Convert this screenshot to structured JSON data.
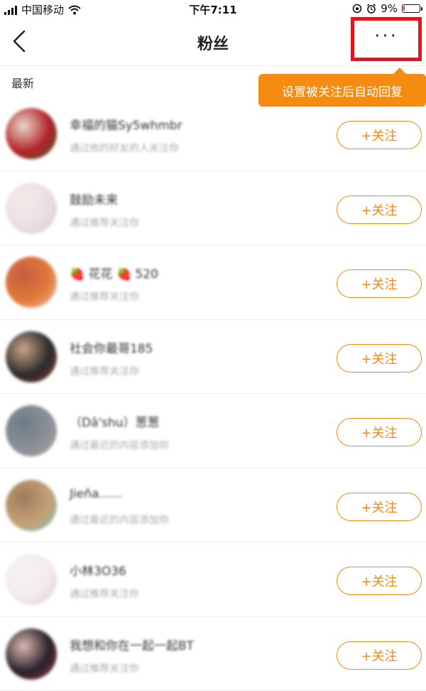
{
  "status_bar": {
    "carrier": "中国移动",
    "time": "下午7:11",
    "battery": "9%",
    "battery_level": 0.09
  },
  "nav": {
    "title": "粉丝",
    "more_label": "···"
  },
  "tooltip": {
    "text": "设置被关注后自动回复"
  },
  "section": {
    "label": "最新"
  },
  "followers": [
    {
      "name": "幸福的猫Sy5whmbr",
      "desc": "通过他的好友的人关注你",
      "button": "+关注",
      "avatar_colors": [
        "#b32028",
        "#2f6b2a",
        "#e8d9c9"
      ]
    },
    {
      "name": "鼓励未来",
      "desc": "通过推荐关注你",
      "button": "+关注",
      "avatar_colors": [
        "#e9dfe3",
        "#d8c6cf",
        "#f2ece9"
      ]
    },
    {
      "name": "🍓 花花 🍓 520",
      "desc": "通过推荐关注你",
      "button": "+关注",
      "avatar_colors": [
        "#e07a3a",
        "#f2c9b1",
        "#c85d40"
      ]
    },
    {
      "name": "社会你最哥185",
      "desc": "通过推荐关注你",
      "button": "+关注",
      "avatar_colors": [
        "#2b2b2b",
        "#8a3b2a",
        "#c9a488"
      ]
    },
    {
      "name": "（Dā'shu）葱葱",
      "desc": "通过最近的内容添加你",
      "button": "+关注",
      "avatar_colors": [
        "#8a8f96",
        "#b9a7a0",
        "#6f7d87"
      ]
    },
    {
      "name": "Jieňa......",
      "desc": "通过最近的内容添加你",
      "button": "+关注",
      "avatar_colors": [
        "#c5a077",
        "#6fc7c3",
        "#9e7b5b"
      ]
    },
    {
      "name": "小林3O36",
      "desc": "通过推荐关注你",
      "button": "+关注",
      "avatar_colors": [
        "#f3eaeb",
        "#e3c7cd",
        "#f7f3f3"
      ]
    },
    {
      "name": "我想和你在一起一起BT",
      "desc": "通过推荐关注你",
      "button": "+关注",
      "avatar_colors": [
        "#2a1f2a",
        "#a23a4a",
        "#d9b8b0"
      ]
    }
  ],
  "colors": {
    "accent": "#f08a15",
    "tooltip_bg": "#f58b10",
    "highlight_border": "#e8141a"
  }
}
